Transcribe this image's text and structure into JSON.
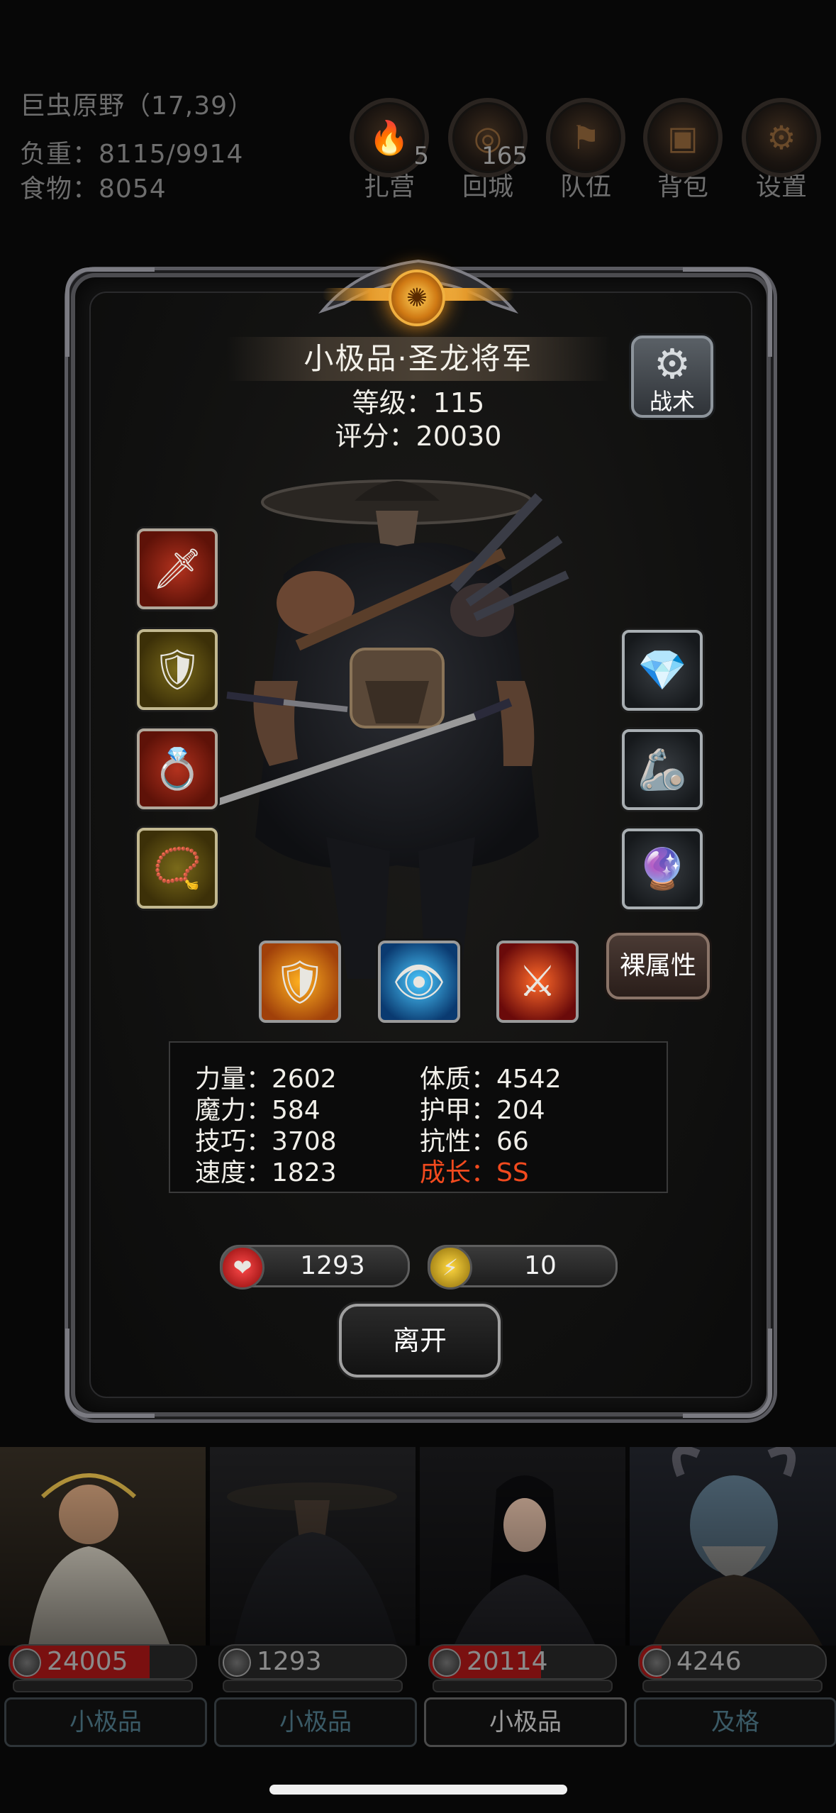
{
  "hud": {
    "location": "巨虫原野（17,39）",
    "load": "负重：8115/9914",
    "food": "食物：8054",
    "buttons": [
      {
        "label": "扎营",
        "badge": "5",
        "icon": "campfire-icon"
      },
      {
        "label": "回城",
        "badge": "165",
        "icon": "portal-icon"
      },
      {
        "label": "队伍",
        "badge": "",
        "icon": "team-icon"
      },
      {
        "label": "背包",
        "badge": "",
        "icon": "backpack-icon"
      },
      {
        "label": "设置",
        "badge": "",
        "icon": "gear-icon"
      }
    ]
  },
  "hero": {
    "name": "小极品·圣龙将军",
    "level": "等级：115",
    "score": "评分：20030",
    "tactics_label": "战术",
    "bare_stats_label": "裸属性"
  },
  "equipment": {
    "left": [
      {
        "name": "dagger-icon",
        "color": "red"
      },
      {
        "name": "armor-icon",
        "color": "gold"
      },
      {
        "name": "ring-icon",
        "color": "red"
      },
      {
        "name": "amulet-icon",
        "color": "gold"
      }
    ],
    "right": [
      {
        "name": "gem-stone-icon",
        "color": "grey"
      },
      {
        "name": "bracer-icon",
        "color": "grey"
      },
      {
        "name": "crystal-icon",
        "color": "grey"
      }
    ]
  },
  "skills": [
    {
      "name": "shield-skill-icon"
    },
    {
      "name": "eye-skill-icon"
    },
    {
      "name": "slash-skill-icon"
    }
  ],
  "stats": {
    "strength": "力量：2602",
    "constitution": "体质：4542",
    "magic": "魔力：584",
    "armor": "护甲：204",
    "skill": "技巧：3708",
    "resistance": "抗性：66",
    "speed": "速度：1823",
    "growth": "成长：SS"
  },
  "bars": {
    "hp": "1293",
    "energy": "10"
  },
  "leave_label": "离开",
  "team": [
    {
      "hp": "24005",
      "hp_fill": 0.75,
      "rank": "小极品",
      "active": false
    },
    {
      "hp": "1293",
      "hp_fill": 0.0,
      "rank": "小极品",
      "active": false
    },
    {
      "hp": "20114",
      "hp_fill": 0.6,
      "rank": "小极品",
      "active": true
    },
    {
      "hp": "4246",
      "hp_fill": 0.12,
      "rank": "及格",
      "active": false
    }
  ],
  "colors": {
    "growth": "#f24a1e",
    "hp_fill": "#7a1010",
    "accent_gold": "#e49a2c"
  }
}
